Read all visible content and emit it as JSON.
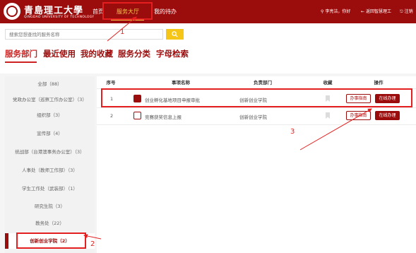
{
  "header": {
    "logo_name": "青島理工大學",
    "logo_sub": "QINGDAO UNIVERSITY OF TECHNOLOGY",
    "nav": [
      "首页",
      "服务大厅",
      "我的待办"
    ],
    "user_greeting": "李亮洁，你好",
    "back_link": "返回智慧理工",
    "logout": "注销"
  },
  "search": {
    "placeholder": "搜索您想查找的服务名称"
  },
  "tabs": [
    "服务部门",
    "最近使用",
    "我的收藏",
    "服务分类",
    "字母检索"
  ],
  "sidebar": {
    "items": [
      "全部（88）",
      "党政办公室（巡察工作办公室）（3）",
      "组织部（3）",
      "宣传部（4）",
      "统战部（台港澳事务办公室）（3）",
      "人事处（教师工作部）（3）",
      "学生工作处（武装部）（1）",
      "研究生院（3）",
      "教务处（22）",
      "创新创业学院（2）"
    ]
  },
  "table": {
    "headers": [
      "序号",
      "事项名称",
      "负责部门",
      "收藏",
      "操作"
    ],
    "rows": [
      {
        "index": "1",
        "name": "创业孵化基地项目申报审批",
        "dept": "创新创业学院",
        "guide": "办事指南",
        "apply": "在线办理"
      },
      {
        "index": "2",
        "name": "竞赛获奖信息上报",
        "dept": "创新创业学院",
        "guide": "办事指南",
        "apply": "在线办理"
      }
    ]
  },
  "annotations": [
    "1",
    "2",
    "3"
  ],
  "colors": {
    "brand": "#9b0d0d",
    "accent": "#f3c64a",
    "annotation": "#e51f1f"
  }
}
